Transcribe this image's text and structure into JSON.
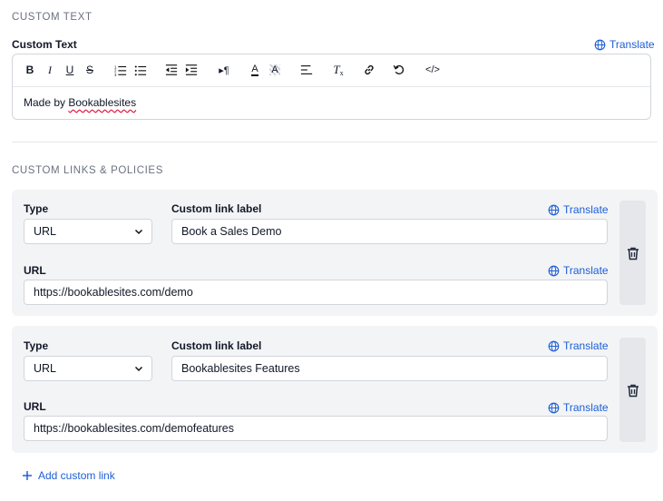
{
  "custom_text": {
    "section_title": "CUSTOM TEXT",
    "field_label": "Custom Text",
    "translate_label": "Translate",
    "content_prefix": "Made by ",
    "content_word": "Bookablesites",
    "toolbar": [
      {
        "name": "bold-icon",
        "glyph": "B"
      },
      {
        "name": "italic-icon",
        "glyph": "I"
      },
      {
        "name": "underline-icon",
        "glyph": "U"
      },
      {
        "name": "strikethrough-icon",
        "glyph": "S"
      },
      {
        "name": "ordered-list-icon"
      },
      {
        "name": "bullet-list-icon"
      },
      {
        "name": "outdent-icon"
      },
      {
        "name": "indent-icon"
      },
      {
        "name": "paragraph-direction-icon",
        "glyph": "▸¶"
      },
      {
        "name": "font-color-icon",
        "glyph": "A"
      },
      {
        "name": "highlight-color-icon",
        "glyph": "A"
      },
      {
        "name": "align-icon"
      },
      {
        "name": "clear-format-icon",
        "glyph": "T"
      },
      {
        "name": "link-icon"
      },
      {
        "name": "undo-icon"
      },
      {
        "name": "code-view-icon",
        "glyph": "</>"
      }
    ]
  },
  "links": {
    "section_title": "CUSTOM LINKS & POLICIES",
    "type_label": "Type",
    "link_label_label": "Custom link label",
    "url_label": "URL",
    "translate_label": "Translate",
    "items": [
      {
        "type": "URL",
        "label": "Book a Sales Demo",
        "url": "https://bookablesites.com/demo"
      },
      {
        "type": "URL",
        "label": "Bookablesites Features",
        "url": "https://bookablesites.com/demofeatures"
      }
    ],
    "add_label": "Add custom link"
  },
  "colors": {
    "accent": "#1d5fd6",
    "card_bg": "#f3f4f6",
    "spell_error": "#e11d48"
  }
}
